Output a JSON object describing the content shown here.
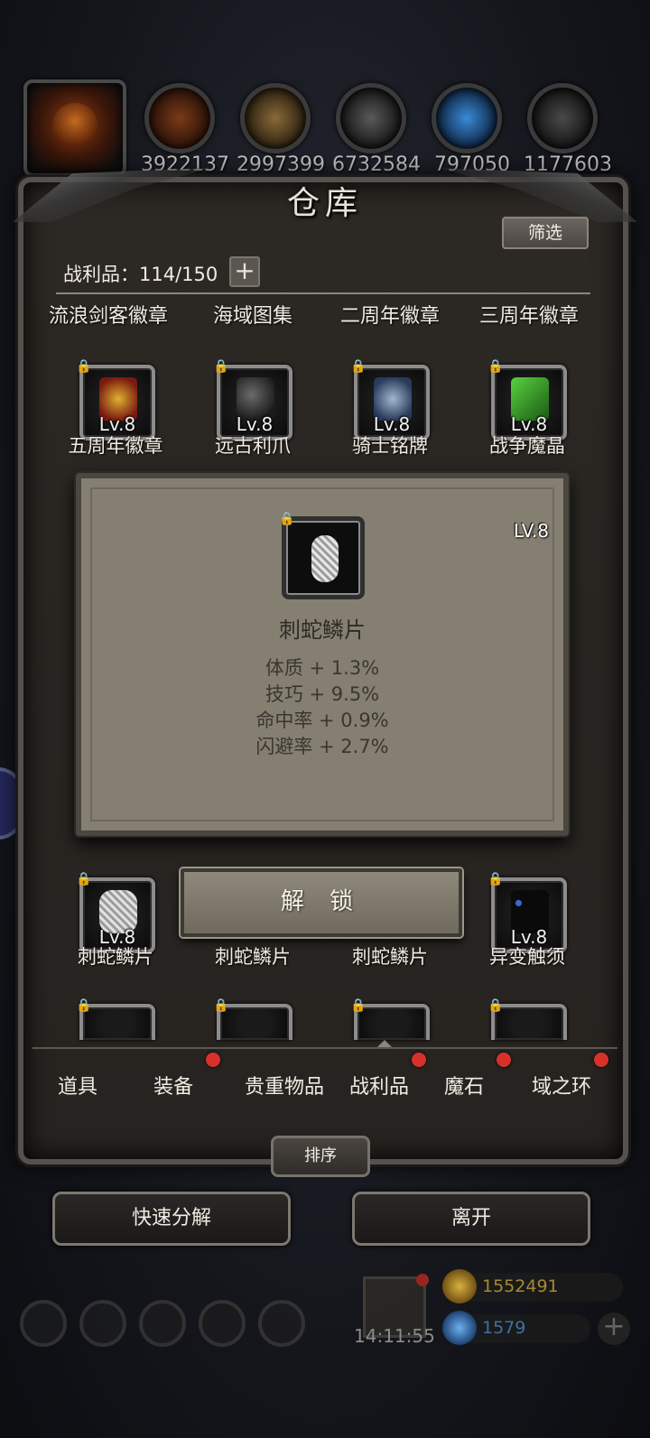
{
  "resources": {
    "values": [
      "3922137",
      "2997399",
      "6732584",
      "797050",
      "1177603"
    ],
    "icon_names": [
      "wood-log-icon",
      "plank-icon",
      "iron-ingot-icon",
      "crystal-icon",
      "stone-icon"
    ]
  },
  "panel": {
    "title": "仓库",
    "filter_label": "筛选",
    "count_label": "战利品：114/150",
    "plus_label": "+"
  },
  "row0_labels": [
    "流浪剑客徽章",
    "海域图集",
    "二周年徽章",
    "三周年徽章"
  ],
  "row1": [
    {
      "name": "五周年徽章",
      "level": "Lv.8",
      "icon": "anniversary-badge-icon"
    },
    {
      "name": "远古利爪",
      "level": "Lv.8",
      "icon": "claw-icon"
    },
    {
      "name": "骑士铭牌",
      "level": "Lv.8",
      "icon": "knight-emblem-icon"
    },
    {
      "name": "战争魔晶",
      "level": "Lv.8",
      "icon": "war-crystal-icon"
    }
  ],
  "popup": {
    "level": "LV.8",
    "name": "刺蛇鳞片",
    "stats": [
      "体质 + 1.3%",
      "技巧 + 9.5%",
      "命中率 + 0.9%",
      "闪避率 + 2.7%"
    ]
  },
  "unlock_label": "解 锁",
  "row3": [
    {
      "name": "刺蛇鳞片",
      "level": "Lv.8",
      "icon": "scale-icon"
    },
    {
      "name": "刺蛇鳞片",
      "level": "",
      "icon": "scale-icon"
    },
    {
      "name": "刺蛇鳞片",
      "level": "",
      "icon": "scale-icon"
    },
    {
      "name": "异变触须",
      "level": "Lv.8",
      "icon": "tentacle-icon"
    }
  ],
  "tabs": [
    {
      "label": "道具",
      "dot": false
    },
    {
      "label": "装备",
      "dot": true
    },
    {
      "label": "贵重物品",
      "dot": false
    },
    {
      "label": "战利品",
      "dot": true
    },
    {
      "label": "魔石",
      "dot": true
    },
    {
      "label": "域之环",
      "dot": true
    }
  ],
  "sort_label": "排序",
  "quick_decompose_label": "快速分解",
  "leave_label": "离开",
  "hud": {
    "timer": "14:11:55",
    "gold": "1552491",
    "gems": "1579"
  },
  "colors": {
    "panel_bg": "#2c2824",
    "popup_bg": "#857f71",
    "badge_red": "#d8312b",
    "gold_text": "#c9a63a",
    "gem_text": "#4a86c8"
  }
}
